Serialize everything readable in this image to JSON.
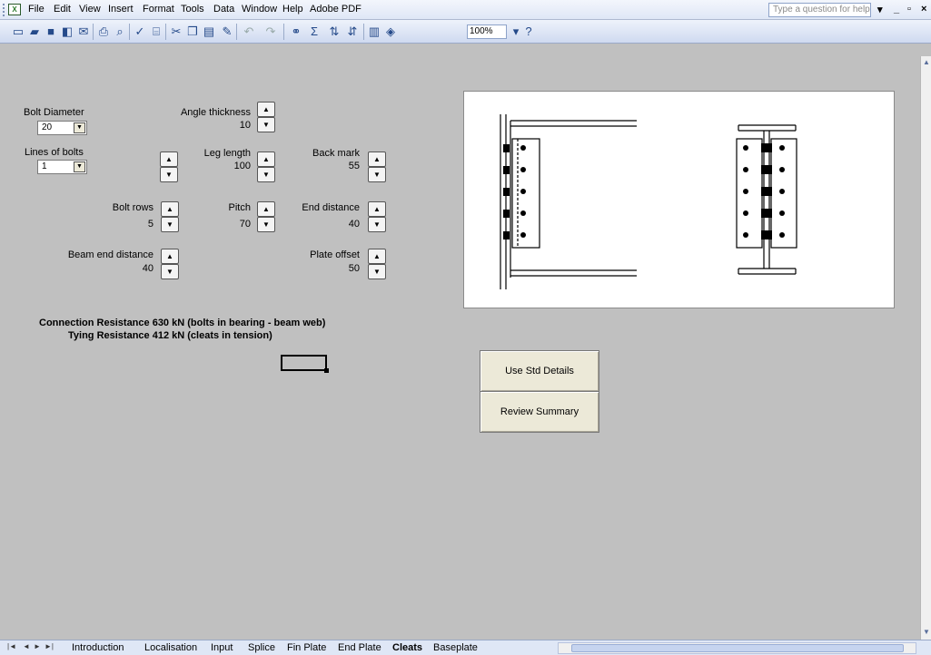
{
  "menu": {
    "items": [
      "File",
      "Edit",
      "View",
      "Insert",
      "Format",
      "Tools",
      "Data",
      "Window",
      "Help",
      "Adobe PDF"
    ],
    "help_placeholder": "Type a question for help"
  },
  "toolbar": {
    "zoom": "100%"
  },
  "inputs": {
    "bolt_diameter": {
      "label": "Bolt Diameter",
      "value": "20"
    },
    "lines_of_bolts": {
      "label": "Lines of bolts",
      "value": "1"
    },
    "angle_thickness": {
      "label": "Angle thickness",
      "value": "10"
    },
    "leg_length": {
      "label": "Leg length",
      "value": "100"
    },
    "back_mark": {
      "label": "Back mark",
      "value": "55"
    },
    "bolt_rows": {
      "label": "Bolt rows",
      "value": "5"
    },
    "pitch": {
      "label": "Pitch",
      "value": "70"
    },
    "end_distance": {
      "label": "End distance",
      "value": "40"
    },
    "beam_end_distance": {
      "label": "Beam end distance",
      "value": "40"
    },
    "plate_offset": {
      "label": "Plate offset",
      "value": "50"
    }
  },
  "results": {
    "connection": "Connection Resistance 630 kN (bolts in bearing - beam web)",
    "tying": "Tying Resistance 412 kN (cleats in tension)"
  },
  "buttons": {
    "std_details": "Use Std Details",
    "review_summary": "Review Summary"
  },
  "sheet_tabs": [
    "Introduction",
    "Localisation",
    "Input",
    "Splice",
    "Fin Plate",
    "End Plate",
    "Cleats",
    "Baseplate"
  ],
  "active_tab": "Cleats"
}
